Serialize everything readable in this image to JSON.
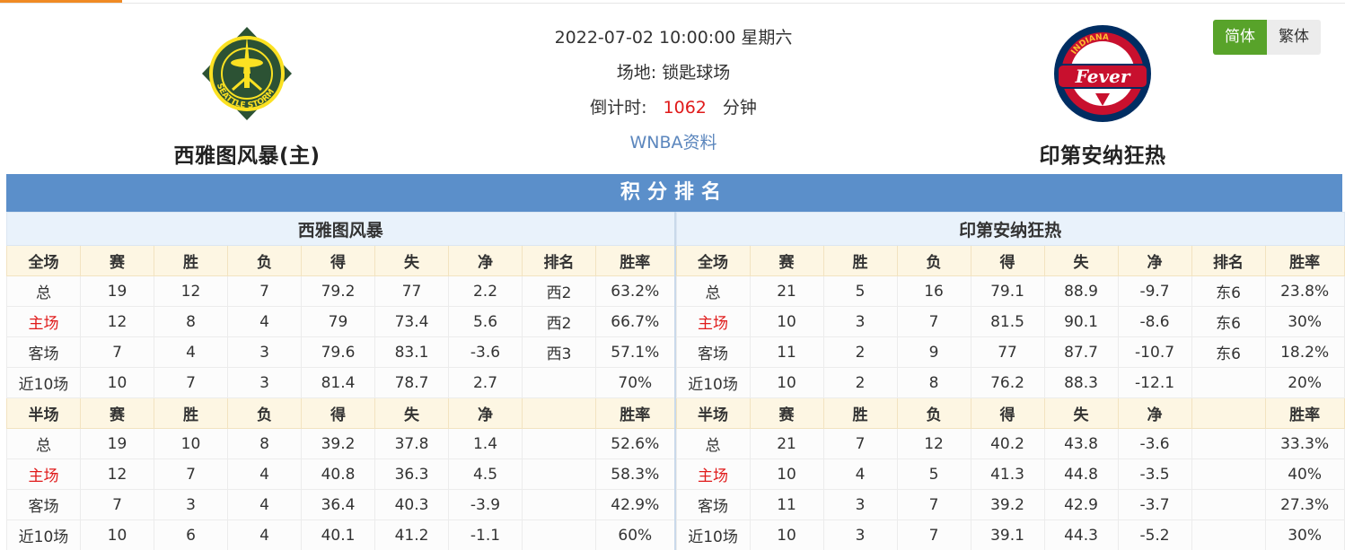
{
  "match": {
    "datetime": "2022-07-02 10:00:00 星期六",
    "venue_label": "场地:",
    "venue": "锁匙球场",
    "countdown_label": "倒计时:",
    "countdown_value": "1062",
    "countdown_unit": "分钟",
    "league_link": "WNBA资料"
  },
  "home": {
    "name": "西雅图风暴(主)",
    "logo_text": "SEATTLE STORM"
  },
  "away": {
    "name": "印第安纳狂热",
    "logo_text_top": "INDIANA",
    "logo_text_main": "Fever"
  },
  "lang": {
    "simplified": "简体",
    "traditional": "繁体"
  },
  "standings": {
    "title": "积分排名",
    "home_team": "西雅图风暴",
    "away_team": "印第安纳狂热",
    "full_headers": [
      "全场",
      "赛",
      "胜",
      "负",
      "得",
      "失",
      "净",
      "排名",
      "胜率"
    ],
    "half_headers": [
      "半场",
      "赛",
      "胜",
      "负",
      "得",
      "失",
      "净",
      "",
      "胜率"
    ],
    "home_full": [
      [
        "总",
        "19",
        "12",
        "7",
        "79.2",
        "77",
        "2.2",
        "西2",
        "63.2%"
      ],
      [
        "主场",
        "12",
        "8",
        "4",
        "79",
        "73.4",
        "5.6",
        "西2",
        "66.7%"
      ],
      [
        "客场",
        "7",
        "4",
        "3",
        "79.6",
        "83.1",
        "-3.6",
        "西3",
        "57.1%"
      ],
      [
        "近10场",
        "10",
        "7",
        "3",
        "81.4",
        "78.7",
        "2.7",
        "",
        "70%"
      ]
    ],
    "home_half": [
      [
        "总",
        "19",
        "10",
        "8",
        "39.2",
        "37.8",
        "1.4",
        "",
        "52.6%"
      ],
      [
        "主场",
        "12",
        "7",
        "4",
        "40.8",
        "36.3",
        "4.5",
        "",
        "58.3%"
      ],
      [
        "客场",
        "7",
        "3",
        "4",
        "36.4",
        "40.3",
        "-3.9",
        "",
        "42.9%"
      ],
      [
        "近10场",
        "10",
        "6",
        "4",
        "40.1",
        "41.2",
        "-1.1",
        "",
        "60%"
      ]
    ],
    "away_full": [
      [
        "总",
        "21",
        "5",
        "16",
        "79.1",
        "88.9",
        "-9.7",
        "东6",
        "23.8%"
      ],
      [
        "主场",
        "10",
        "3",
        "7",
        "81.5",
        "90.1",
        "-8.6",
        "东6",
        "30%"
      ],
      [
        "客场",
        "11",
        "2",
        "9",
        "77",
        "87.7",
        "-10.7",
        "东6",
        "18.2%"
      ],
      [
        "近10场",
        "10",
        "2",
        "8",
        "76.2",
        "88.3",
        "-12.1",
        "",
        "20%"
      ]
    ],
    "away_half": [
      [
        "总",
        "21",
        "7",
        "12",
        "40.2",
        "43.8",
        "-3.6",
        "",
        "33.3%"
      ],
      [
        "主场",
        "10",
        "4",
        "5",
        "41.3",
        "44.8",
        "-3.5",
        "",
        "40%"
      ],
      [
        "客场",
        "11",
        "3",
        "7",
        "39.2",
        "42.9",
        "-3.7",
        "",
        "27.3%"
      ],
      [
        "近10场",
        "10",
        "3",
        "7",
        "39.1",
        "44.3",
        "-5.2",
        "",
        "30%"
      ]
    ]
  },
  "colors": {
    "accent_green": "#58a32a",
    "banner_blue": "#5b8fca",
    "highlight_red": "#e01a1a",
    "link_blue": "#5b86bd"
  }
}
